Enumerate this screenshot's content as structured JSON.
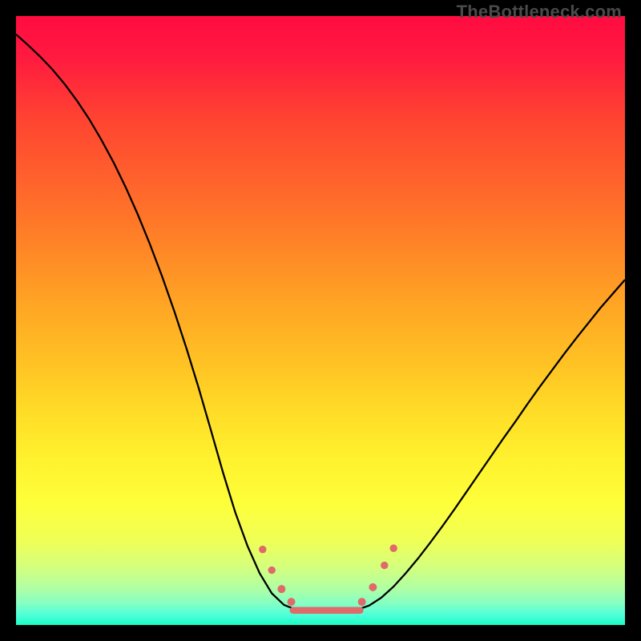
{
  "watermark": {
    "text": "TheBottleneck.com"
  },
  "chart_data": {
    "type": "line",
    "title": "",
    "xlabel": "",
    "ylabel": "",
    "xlim": [
      0,
      100
    ],
    "ylim": [
      0,
      100
    ],
    "grid": false,
    "background": {
      "type": "vertical-gradient",
      "stops": [
        {
          "pos": 0.0,
          "color": "#ff0b41"
        },
        {
          "pos": 0.07,
          "color": "#ff1b3f"
        },
        {
          "pos": 0.17,
          "color": "#ff4431"
        },
        {
          "pos": 0.27,
          "color": "#ff622c"
        },
        {
          "pos": 0.37,
          "color": "#ff8227"
        },
        {
          "pos": 0.47,
          "color": "#ffa424"
        },
        {
          "pos": 0.57,
          "color": "#ffc224"
        },
        {
          "pos": 0.65,
          "color": "#ffdc27"
        },
        {
          "pos": 0.73,
          "color": "#fff22e"
        },
        {
          "pos": 0.8,
          "color": "#feff3a"
        },
        {
          "pos": 0.86,
          "color": "#f0ff55"
        },
        {
          "pos": 0.905,
          "color": "#d4ff7d"
        },
        {
          "pos": 0.94,
          "color": "#b0ffa4"
        },
        {
          "pos": 0.965,
          "color": "#84ffc4"
        },
        {
          "pos": 0.985,
          "color": "#4bffd9"
        },
        {
          "pos": 1.0,
          "color": "#18ffc3"
        }
      ]
    },
    "series": [
      {
        "name": "left-curve",
        "color": "#000000",
        "width": 2.3,
        "x": [
          0,
          2,
          4,
          6,
          8,
          10,
          12,
          14,
          16,
          18,
          20,
          22,
          24,
          26,
          28,
          30,
          32,
          34,
          36,
          38,
          40,
          42,
          44,
          46
        ],
        "y": [
          97,
          95.2,
          93.3,
          91.2,
          88.8,
          86.1,
          83.1,
          79.7,
          76.0,
          71.9,
          67.4,
          62.5,
          57.2,
          51.5,
          45.4,
          38.9,
          32.0,
          25.0,
          18.5,
          13.0,
          8.5,
          5.2,
          3.3,
          2.5
        ]
      },
      {
        "name": "right-curve",
        "color": "#000000",
        "width": 2.3,
        "x": [
          56,
          58,
          60,
          62,
          64,
          66,
          68,
          70,
          72,
          74,
          76,
          78,
          80,
          82,
          84,
          86,
          88,
          90,
          92,
          94,
          96,
          98,
          100
        ],
        "y": [
          2.5,
          3.2,
          4.5,
          6.3,
          8.5,
          10.9,
          13.5,
          16.2,
          19.0,
          21.9,
          24.8,
          27.7,
          30.6,
          33.4,
          36.3,
          39.1,
          41.8,
          44.5,
          47.1,
          49.6,
          52.1,
          54.4,
          56.7
        ]
      },
      {
        "name": "valley-floor",
        "color": "#e06a6a",
        "width": 8.5,
        "linecap": "round",
        "x": [
          45.5,
          56.5
        ],
        "y": [
          2.4,
          2.4
        ]
      }
    ],
    "markers": [
      {
        "name": "left-dot-1",
        "x": 40.5,
        "y": 12.4,
        "r": 4.7,
        "color": "#e06a6a"
      },
      {
        "name": "left-dot-2",
        "x": 42.0,
        "y": 9.0,
        "r": 4.7,
        "color": "#e06a6a"
      },
      {
        "name": "left-dot-3",
        "x": 43.6,
        "y": 5.9,
        "r": 5.0,
        "color": "#e06a6a"
      },
      {
        "name": "left-dot-4",
        "x": 45.2,
        "y": 3.8,
        "r": 5.0,
        "color": "#e06a6a"
      },
      {
        "name": "right-dot-1",
        "x": 56.8,
        "y": 3.8,
        "r": 5.0,
        "color": "#e06a6a"
      },
      {
        "name": "right-dot-2",
        "x": 58.6,
        "y": 6.2,
        "r": 5.0,
        "color": "#e06a6a"
      },
      {
        "name": "right-dot-3",
        "x": 60.5,
        "y": 9.8,
        "r": 4.7,
        "color": "#e06a6a"
      },
      {
        "name": "right-dot-4",
        "x": 62.0,
        "y": 12.6,
        "r": 4.7,
        "color": "#e06a6a"
      }
    ]
  }
}
